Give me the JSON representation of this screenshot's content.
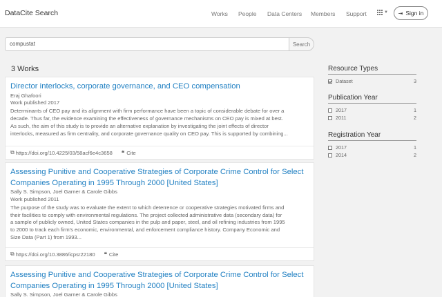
{
  "navbar": {
    "brand": "DataCite Search",
    "links": [
      "Works",
      "People",
      "Data Centers",
      "Members",
      "Support"
    ],
    "signin_label": "Sign in"
  },
  "search": {
    "value": "compustat",
    "button_label": "Search"
  },
  "results": {
    "count_label": "3 Works",
    "items": [
      {
        "title": "Director interlocks, corporate governance, and CEO compensation",
        "authors": "Eraj Ghafoori",
        "published": "Work published 2017",
        "description": [
          "Determinants of CEO pay and its alignment with firm performance have been a topic of considerable debate for over a",
          "decade. Thus far, the evidence examining the effectiveness of governance mechanisms on CEO pay is mixed at best.",
          "As such, the aim of this study is to provide an alternative explanation by investigating the joint effects of director",
          "interlocks, measured as firm centrality, and corporate governance quality on CEO pay. This is supported by combining..."
        ],
        "doi": "https://doi.org/10.4225/03/58acf6e4c3658",
        "cite_label": "Cite"
      },
      {
        "title": "Assessing Punitive and Cooperative Strategies of Corporate Crime Control for Select Companies Operating in 1995 Through 2000 [United States]",
        "authors": "Sally S. Simpson, Joel Garner & Carole Gibbs",
        "published": "Work published 2011",
        "description": [
          "The purpose of the study was to evaluate the extent to which deterrence or cooperative strategies motivated firms and",
          "their facilities to comply with environmental regulations. The project collected administrative data (secondary data) for",
          "a sample of publicly owned, United States companies in the pulp and paper, steel, and oil refining industries from 1995",
          "to 2000 to track each firm's economic, environmental, and enforcement compliance history. Company Economic and",
          "Size Data (Part 1) from 1993..."
        ],
        "doi": "https://doi.org/10.3886/icpsr22180",
        "cite_label": "Cite"
      },
      {
        "title": "Assessing Punitive and Cooperative Strategies of Corporate Crime Control for Select Companies Operating in 1995 Through 2000 [United States]",
        "authors": "Sally S. Simpson, Joel Garner & Carole Gibbs"
      }
    ]
  },
  "facets": {
    "resource_types": {
      "title": "Resource Types",
      "items": [
        {
          "label": "Dataset",
          "count": "3",
          "checked": true
        }
      ]
    },
    "publication_year": {
      "title": "Publication Year",
      "items": [
        {
          "label": "2017",
          "count": "1"
        },
        {
          "label": "2011",
          "count": "2"
        }
      ]
    },
    "registration_year": {
      "title": "Registration Year",
      "items": [
        {
          "label": "2017",
          "count": "1"
        },
        {
          "label": "2014",
          "count": "2"
        }
      ]
    }
  }
}
